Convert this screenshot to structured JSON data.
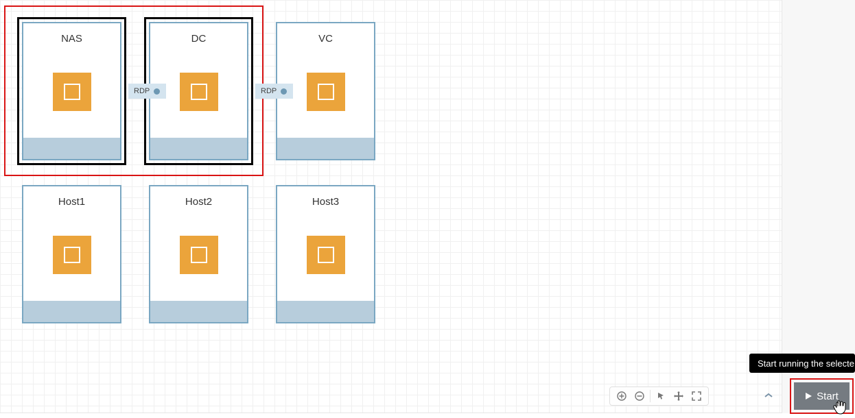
{
  "nodes": {
    "nas": {
      "label": "NAS"
    },
    "dc": {
      "label": "DC"
    },
    "vc": {
      "label": "VC"
    },
    "host1": {
      "label": "Host1"
    },
    "host2": {
      "label": "Host2"
    },
    "host3": {
      "label": "Host3"
    }
  },
  "connections": {
    "nas_dc": {
      "label": "RDP"
    },
    "dc_vc": {
      "label": "RDP"
    }
  },
  "toolbar": {
    "zoom_in": "plus-icon",
    "zoom_out": "minus-icon",
    "pointer": "pointer-icon",
    "pan": "move-icon",
    "fit": "expand-icon"
  },
  "start_button": {
    "label": "Start",
    "tooltip": "Start running the selecte"
  },
  "colors": {
    "node_border": "#7aa7c2",
    "node_footer": "#b7cddc",
    "node_icon": "#eba43b",
    "selection": "#d91414",
    "start_bg": "#757b81"
  }
}
